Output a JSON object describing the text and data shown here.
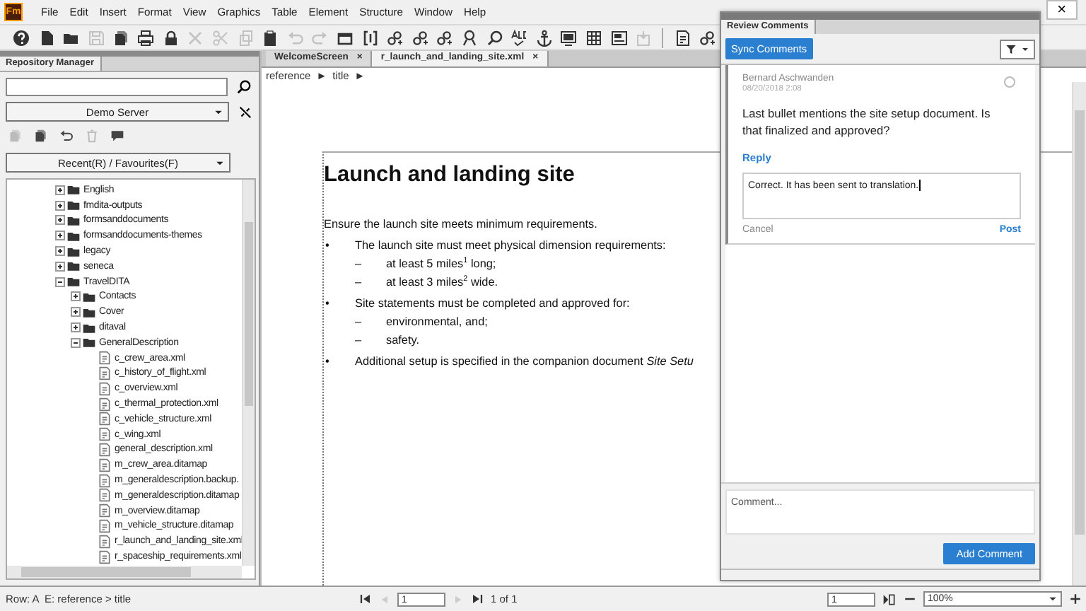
{
  "app_icon": "Fm",
  "menu": [
    "File",
    "Edit",
    "Insert",
    "Format",
    "View",
    "Graphics",
    "Table",
    "Element",
    "Structure",
    "Window",
    "Help"
  ],
  "window_close": "×",
  "toolbar": [
    {
      "kind": "help",
      "disabled": false
    },
    {
      "kind": "document",
      "disabled": false
    },
    {
      "kind": "folder",
      "disabled": false
    },
    {
      "kind": "save",
      "disabled": true
    },
    {
      "kind": "documents",
      "disabled": false
    },
    {
      "kind": "print",
      "disabled": false
    },
    {
      "kind": "lock",
      "disabled": false
    },
    {
      "kind": "cross",
      "disabled": true
    },
    {
      "kind": "scissors",
      "disabled": true
    },
    {
      "kind": "copy",
      "disabled": true
    },
    {
      "kind": "clipboard",
      "disabled": false
    },
    {
      "kind": "undo",
      "disabled": true
    },
    {
      "kind": "redo",
      "disabled": true
    },
    {
      "kind": "frame",
      "disabled": false
    },
    {
      "kind": "bracket",
      "disabled": false
    },
    {
      "kind": "chain",
      "disabled": false
    },
    {
      "kind": "chain",
      "disabled": false
    },
    {
      "kind": "chain",
      "disabled": false
    },
    {
      "kind": "person",
      "disabled": false
    },
    {
      "kind": "search",
      "disabled": false
    },
    {
      "kind": "spellcheck",
      "disabled": false
    },
    {
      "kind": "anchor",
      "disabled": false
    },
    {
      "kind": "monitor",
      "disabled": false
    },
    {
      "kind": "table",
      "disabled": false
    },
    {
      "kind": "image",
      "disabled": false
    },
    {
      "kind": "import",
      "disabled": true
    }
  ],
  "toolbar_2": [
    {
      "kind": "report",
      "disabled": false
    },
    {
      "kind": "chain",
      "disabled": false
    }
  ],
  "repository_manager": {
    "title": "Repository Manager",
    "server": "Demo Server",
    "actions": [
      {
        "kind": "documents",
        "disabled": true
      },
      {
        "kind": "documents",
        "disabled": false
      },
      {
        "kind": "undo",
        "disabled": false
      },
      {
        "kind": "trash",
        "disabled": true
      },
      {
        "kind": "speech",
        "disabled": false
      }
    ],
    "view": "Recent(R) / Favourites(F)",
    "tree": [
      {
        "label": "English",
        "kind": "folder",
        "expanded": false
      },
      {
        "label": "fmdita-outputs",
        "kind": "folder",
        "expanded": false
      },
      {
        "label": "formsanddocuments",
        "kind": "folder",
        "expanded": false
      },
      {
        "label": "formsanddocuments-themes",
        "kind": "folder",
        "expanded": false
      },
      {
        "label": "legacy",
        "kind": "folder",
        "expanded": false
      },
      {
        "label": "seneca",
        "kind": "folder",
        "expanded": false
      },
      {
        "label": "TravelDITA",
        "kind": "folder",
        "expanded": true,
        "children": [
          {
            "label": "Contacts",
            "kind": "folder",
            "expanded": false
          },
          {
            "label": "Cover",
            "kind": "folder",
            "expanded": false
          },
          {
            "label": "ditaval",
            "kind": "folder",
            "expanded": false
          },
          {
            "label": "GeneralDescription",
            "kind": "folder",
            "expanded": true,
            "children": [
              {
                "label": "c_crew_area.xml",
                "kind": "file"
              },
              {
                "label": "c_history_of_flight.xml",
                "kind": "file"
              },
              {
                "label": "c_overview.xml",
                "kind": "file"
              },
              {
                "label": "c_thermal_protection.xml",
                "kind": "file"
              },
              {
                "label": "c_vehicle_structure.xml",
                "kind": "file"
              },
              {
                "label": "c_wing.xml",
                "kind": "file"
              },
              {
                "label": "general_description.xml",
                "kind": "file"
              },
              {
                "label": "m_crew_area.ditamap",
                "kind": "file"
              },
              {
                "label": "m_generaldescription.backup.",
                "kind": "file"
              },
              {
                "label": "m_generaldescription.ditamap",
                "kind": "file"
              },
              {
                "label": "m_overview.ditamap",
                "kind": "file"
              },
              {
                "label": "m_vehicle_structure.ditamap",
                "kind": "file"
              },
              {
                "label": "r_launch_and_landing_site.xml",
                "kind": "file"
              },
              {
                "label": "r_spaceship_requirements.xml",
                "kind": "file"
              }
            ]
          }
        ]
      }
    ]
  },
  "editor": {
    "tabs": [
      {
        "label": "WelcomeScreen",
        "close": "×",
        "selected": false
      },
      {
        "label": "r_launch_and_landing_site.xml",
        "close": "×",
        "selected": true
      }
    ],
    "breadcrumb": [
      {
        "label": "reference",
        "arrow": "►"
      },
      {
        "label": "title",
        "arrow": "►"
      }
    ],
    "document": {
      "title": "Launch and landing site",
      "blocks": [
        {
          "kind": "para",
          "text": "Ensure the launch site meets minimum requirements."
        },
        {
          "kind": "bullet",
          "mark": "•",
          "text": "The launch site must meet physical dimension requirements:",
          "children": [
            {
              "kind": "dash",
              "mark": "–",
              "text": "at least 5 miles$^{1}$ long;"
            },
            {
              "kind": "dash",
              "mark": "–",
              "text": "at least 3 miles$^{2}$ wide."
            }
          ]
        },
        {
          "kind": "bullet",
          "mark": "•",
          "text": "Site statements must be completed and approved for:",
          "children": [
            {
              "kind": "dash",
              "mark": "–",
              "text": "environmental, and;"
            },
            {
              "kind": "dash",
              "mark": "–",
              "text": "safety."
            }
          ]
        },
        {
          "kind": "bullet",
          "mark": "•",
          "text": "Additional setup is specified in the companion document *Site Setu*"
        }
      ]
    }
  },
  "review_comments": {
    "title": "Review Comments",
    "sync_button": "Sync Comments",
    "comments": [
      {
        "author": "Bernard Aschwanden",
        "date": "08/20/2018 2:08",
        "resolved": false,
        "text": "Last bullet mentions the site setup document. Is that finalized and approved?",
        "reply_link": "Reply",
        "reply": {
          "value": "Correct. It has been sent to translation.",
          "cancel": "Cancel",
          "post": "Post"
        }
      }
    ],
    "new_comment": {
      "placeholder": "Comment..."
    },
    "add_button": "Add Comment"
  },
  "status": {
    "position": "Row: A  E: reference > title",
    "page_field": "1",
    "page_count": "1 of 1",
    "page_field_2": "1",
    "zoom": "100%"
  }
}
